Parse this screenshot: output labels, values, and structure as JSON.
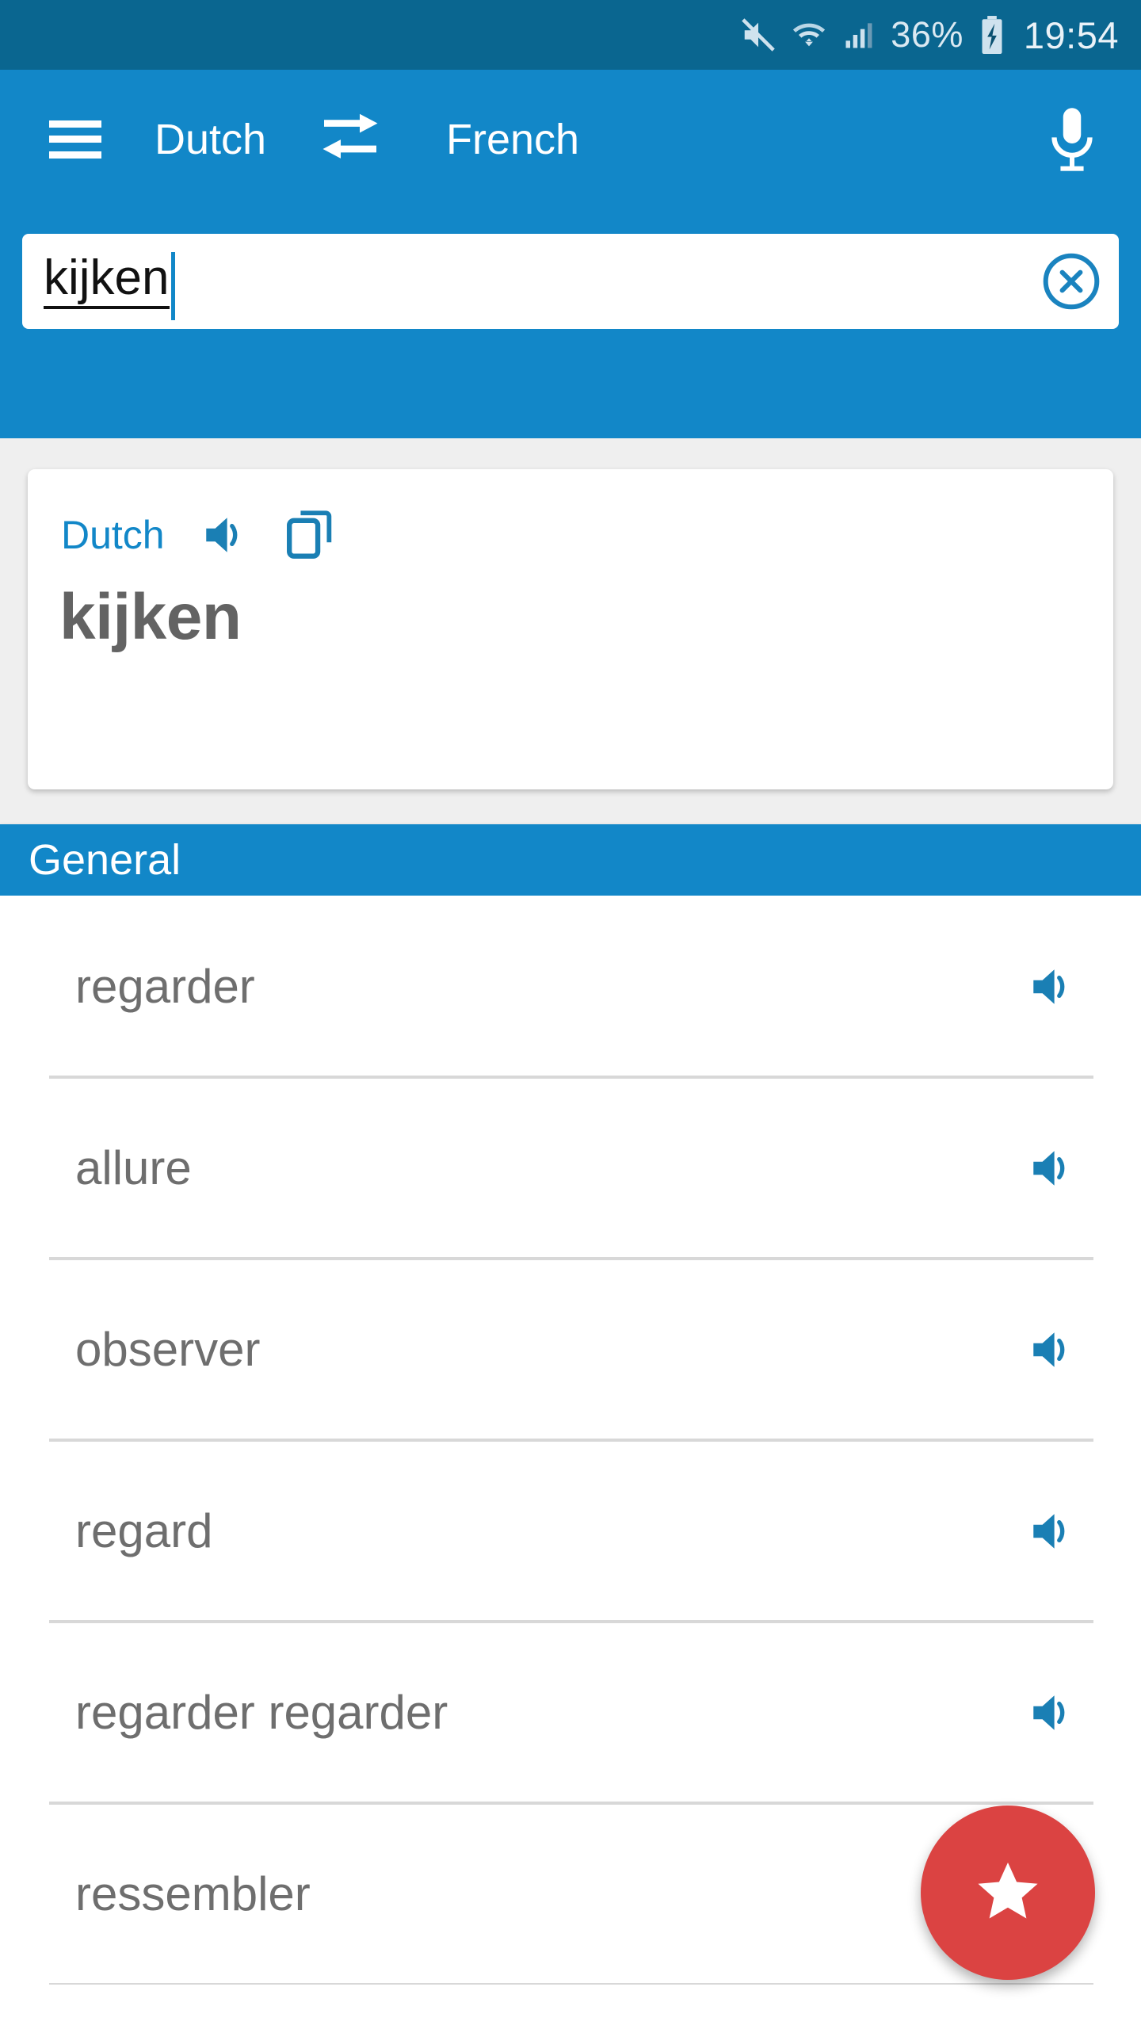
{
  "status_bar": {
    "battery_percent": "36%",
    "clock": "19:54",
    "icons": [
      "mute-icon",
      "wifi-icon",
      "cellular-signal-icon",
      "battery-charging-icon"
    ],
    "background_color": "#0a6690",
    "text_color": "#dbe9f2"
  },
  "app_bar": {
    "menu_icon": "hamburger-menu-icon",
    "source_language": "Dutch",
    "swap_icon": "swap-languages-icon",
    "target_language": "French",
    "mic_icon": "microphone-icon",
    "background_color": "#1287c8"
  },
  "search": {
    "value": "kijken",
    "placeholder": "",
    "clear_icon": "clear-circle-icon",
    "caret_color": "#1287c8"
  },
  "word_card": {
    "language_label": "Dutch",
    "speaker_icon": "speaker-icon",
    "copy_icon": "copy-icon",
    "headword": "kijken",
    "label_color": "#1287c8",
    "headword_color": "#636363"
  },
  "section": {
    "title": "General",
    "background_color": "#1287c8"
  },
  "results": [
    {
      "term": "regarder",
      "speaker_icon": "speaker-icon"
    },
    {
      "term": "allure",
      "speaker_icon": "speaker-icon"
    },
    {
      "term": "observer",
      "speaker_icon": "speaker-icon"
    },
    {
      "term": "regard",
      "speaker_icon": "speaker-icon"
    },
    {
      "term": "regarder regarder",
      "speaker_icon": "speaker-icon"
    },
    {
      "term": "ressembler",
      "speaker_icon": "speaker-icon"
    }
  ],
  "fab": {
    "icon": "star-icon",
    "background_color": "#db4342",
    "icon_color": "#ffffff"
  }
}
